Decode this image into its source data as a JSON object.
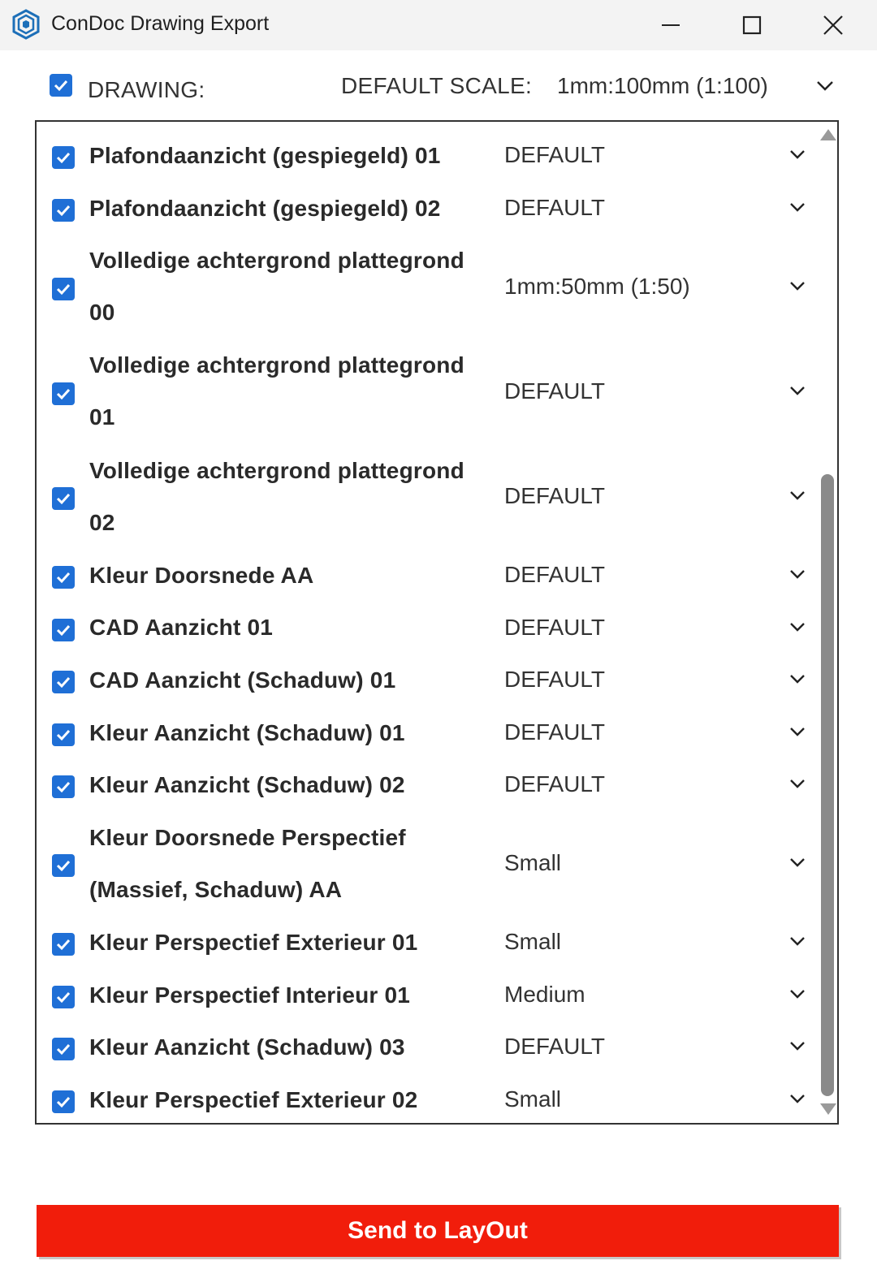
{
  "window": {
    "title": "ConDoc Drawing Export"
  },
  "header": {
    "drawing_label": "DRAWING:",
    "default_scale_label": "DEFAULT SCALE:",
    "default_scale_value": "1mm:100mm (1:100)",
    "all_checked": true
  },
  "drawings": [
    {
      "name": "Plafondaanzicht (gespiegeld) 01",
      "scale": "DEFAULT",
      "checked": true
    },
    {
      "name": "Plafondaanzicht (gespiegeld) 02",
      "scale": "DEFAULT",
      "checked": true
    },
    {
      "name": "Volledige achtergrond plattegrond 00",
      "scale": "1mm:50mm (1:50)",
      "checked": true
    },
    {
      "name": "Volledige achtergrond plattegrond 01",
      "scale": "DEFAULT",
      "checked": true
    },
    {
      "name": "Volledige achtergrond plattegrond 02",
      "scale": "DEFAULT",
      "checked": true
    },
    {
      "name": "Kleur Doorsnede AA",
      "scale": "DEFAULT",
      "checked": true
    },
    {
      "name": "CAD Aanzicht 01",
      "scale": "DEFAULT",
      "checked": true
    },
    {
      "name": "CAD Aanzicht (Schaduw) 01",
      "scale": "DEFAULT",
      "checked": true
    },
    {
      "name": "Kleur Aanzicht (Schaduw) 01",
      "scale": "DEFAULT",
      "checked": true
    },
    {
      "name": "Kleur Aanzicht (Schaduw) 02",
      "scale": "DEFAULT",
      "checked": true
    },
    {
      "name": "Kleur Doorsnede Perspectief (Massief, Schaduw) AA",
      "scale": "Small",
      "checked": true
    },
    {
      "name": "Kleur Perspectief Exterieur 01",
      "scale": "Small",
      "checked": true
    },
    {
      "name": "Kleur Perspectief Interieur 01",
      "scale": "Medium",
      "checked": true
    },
    {
      "name": "Kleur Aanzicht (Schaduw) 03",
      "scale": "DEFAULT",
      "checked": true
    },
    {
      "name": "Kleur Perspectief Exterieur 02",
      "scale": "Small",
      "checked": true
    }
  ],
  "footer": {
    "send_label": "Send to LayOut"
  },
  "colors": {
    "accent": "#1f6fd6",
    "send_button": "#f11d0b"
  }
}
